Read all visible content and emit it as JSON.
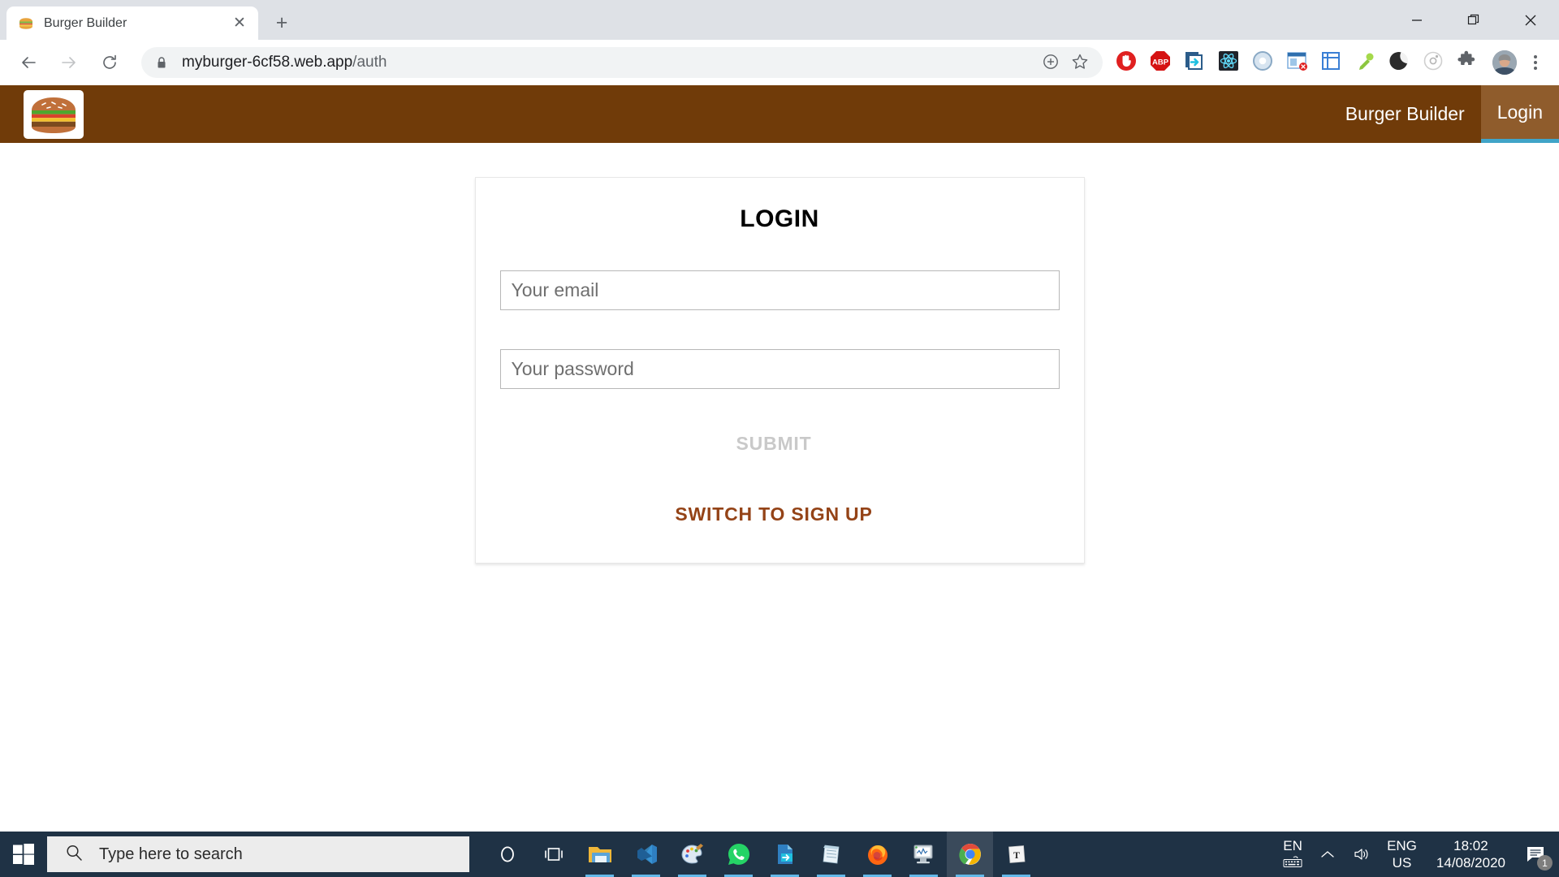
{
  "browser": {
    "tab": {
      "title": "Burger Builder",
      "favicon": "burger-favicon",
      "close": "✕"
    },
    "new_tab_label": "+",
    "window_controls": {
      "minimize": "minimize-icon",
      "maximize": "maximize-icon",
      "close": "close-icon"
    },
    "nav": {
      "back": "back-arrow-icon",
      "forward": "forward-arrow-icon",
      "reload": "reload-icon"
    },
    "omnibox": {
      "lock": "lock-icon",
      "url_host": "myburger-6cf58.web.app",
      "url_path": "/auth",
      "install_icon": "install-app-icon",
      "bookmark_icon": "star-icon"
    },
    "extensions": [
      {
        "name": "adblock-icon",
        "label": ""
      },
      {
        "name": "adblock-plus-icon",
        "label": "ABP"
      },
      {
        "name": "import-export-icon",
        "label": ""
      },
      {
        "name": "react-devtools-icon",
        "label": ""
      },
      {
        "name": "blue-ring-icon",
        "label": ""
      },
      {
        "name": "clear-cache-icon",
        "label": ""
      },
      {
        "name": "window-resizer-icon",
        "label": ""
      },
      {
        "name": "colorzilla-icon",
        "label": ""
      },
      {
        "name": "dark-mode-icon",
        "label": ""
      },
      {
        "name": "wheel-icon",
        "label": ""
      },
      {
        "name": "puzzle-extensions-icon",
        "label": ""
      }
    ],
    "profile_avatar": "user-avatar",
    "menu": "three-dot-menu-icon"
  },
  "navbar": {
    "logo": "burger-logo",
    "links": [
      {
        "label": "Burger Builder",
        "active": false
      },
      {
        "label": "Login",
        "active": true
      }
    ]
  },
  "auth_card": {
    "title": "LOGIN",
    "email": {
      "value": "",
      "placeholder": "Your email"
    },
    "password": {
      "value": "",
      "placeholder": "Your password"
    },
    "submit_label": "SUBMIT",
    "switch_label": "SWITCH TO SIGN UP",
    "submit_color": "#c9c9c9",
    "switch_color": "#944317"
  },
  "theme": {
    "navbar_bg": "#703b09",
    "navbar_active_bg": "#8f5c2c",
    "navbar_underline": "#40a4c8",
    "taskbar_bg": "#1f3245"
  },
  "taskbar": {
    "start": "windows-start-icon",
    "search": {
      "placeholder": "Type here to search",
      "icon": "search-icon"
    },
    "items": [
      {
        "name": "cortana-icon",
        "running": false,
        "active": false
      },
      {
        "name": "task-view-icon",
        "running": false,
        "active": false
      },
      {
        "name": "file-explorer-icon",
        "running": true,
        "active": false
      },
      {
        "name": "vs-code-icon",
        "running": true,
        "active": false
      },
      {
        "name": "paint-icon",
        "running": true,
        "active": false
      },
      {
        "name": "whatsapp-icon",
        "running": true,
        "active": false
      },
      {
        "name": "export-file-icon",
        "running": true,
        "active": false
      },
      {
        "name": "sticky-notes-icon",
        "running": true,
        "active": false
      },
      {
        "name": "firefox-icon",
        "running": true,
        "active": false
      },
      {
        "name": "system-monitor-icon",
        "running": true,
        "active": false
      },
      {
        "name": "chrome-icon",
        "running": true,
        "active": true
      },
      {
        "name": "text-editor-icon",
        "running": true,
        "active": false
      }
    ],
    "tray": {
      "language_line1": "EN",
      "keyboard_icon": "keyboard-icon",
      "chevron_icon": "chevron-up-icon",
      "volume_icon": "volume-icon",
      "input_line1": "ENG",
      "input_line2": "US",
      "time": "18:02",
      "date": "14/08/2020",
      "notification_icon": "notification-icon",
      "notification_count": "1"
    }
  }
}
